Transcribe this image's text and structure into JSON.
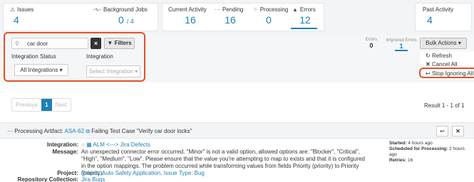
{
  "stats": {
    "issues": {
      "label": "Issues",
      "value": "4"
    },
    "jobs": {
      "label": "Background Jobs",
      "value": "0",
      "total": "/ 4"
    },
    "current": {
      "label": "Current Activity",
      "value": "16"
    },
    "pending": {
      "label": "Pending",
      "value": "16"
    },
    "processing": {
      "label": "Processing",
      "value": "0"
    },
    "errors": {
      "label": "Errors",
      "value": "12"
    },
    "past": {
      "label": "Past Activity",
      "value": "4"
    }
  },
  "filters": {
    "search_value": "car door",
    "clear_label": "×",
    "filters_label": "Filters",
    "integration_status_label": "Integration Status",
    "integration_status_value": "All Integrations",
    "integration_label": "Integration",
    "integration_placeholder": "Select Integration"
  },
  "mini": {
    "errors_label": "Errors",
    "errors_value": "0",
    "ignored_label": "Ignored Errors",
    "ignored_value": "1"
  },
  "bulk": {
    "label": "Bulk Actions",
    "items": [
      "Refresh",
      "Cancel All",
      "Stop Ignoring All"
    ]
  },
  "pager": {
    "previous": "Previous",
    "current": "1",
    "next": "Next",
    "result": "Result 1 - 1 of 1"
  },
  "artifact": {
    "prefix": "Processing Artifact:",
    "link": "ASA-62",
    "title": "Failing Test Case \"Verify car door locks\"",
    "integration_label": "Integration:",
    "integration_value": "ALM <---> Jira Defects",
    "message_label": "Message:",
    "message_value": "An unexpected connector error occurred. \"Minor\" is not a valid option, allowed options are: \"Blocker\", \"Critical\", \"High\", \"Medium\", \"Low\". Please ensure that the value you're attempting to map to exists and that it is configured in the option mappings. The problem occurred while transforming values from fields Priority (priority) to Priority (priority).",
    "project_label": "Project:",
    "project_value": "Project: Auto Safety Application, Issue Type: Bug",
    "repo_label": "Repository Collection:",
    "repo_value": "Jira Bugs",
    "started_label": "Started:",
    "started_value": "4 hours ago",
    "scheduled_label": "Scheduled for Processing:",
    "scheduled_value": "2 hours ago",
    "retries_label": "Retries:",
    "retries_value": "16"
  }
}
